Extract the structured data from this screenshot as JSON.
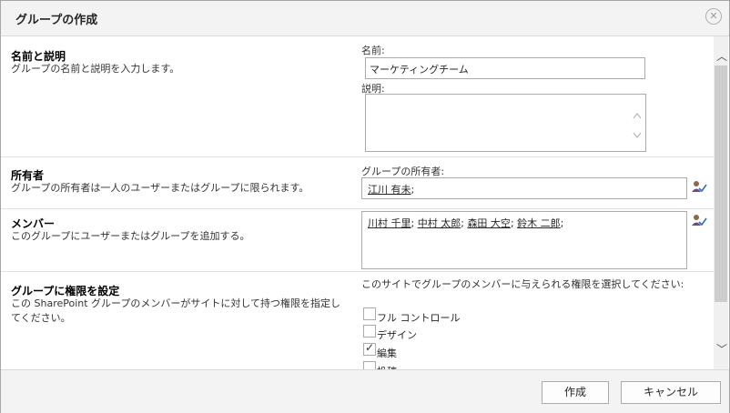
{
  "dialog": {
    "title": "グループの作成",
    "close_icon": "close-circle-icon"
  },
  "sections": {
    "name": {
      "title": "名前と説明",
      "description": "グループの名前と説明を入力します。",
      "name_label": "名前:",
      "name_value": "マーケティングチーム",
      "desc_label": "説明:",
      "desc_value": ""
    },
    "owner": {
      "title": "所有者",
      "description": "グループの所有者は一人のユーザーまたはグループに限られます。",
      "field_label": "グループの所有者:",
      "owner": "江川 有未",
      "separator": ";"
    },
    "members": {
      "title": "メンバー",
      "description": "このグループにユーザーまたはグループを追加する。",
      "people": [
        "川村 千里",
        "中村 太郎",
        "森田 大空",
        "鈴木 二郎"
      ],
      "separator": ";"
    },
    "permissions": {
      "title": "グループに権限を設定",
      "description": "この SharePoint グループのメンバーがサイトに対して持つ権限を指定してください。",
      "instruction": "このサイトでグループのメンバーに与えられる権限を選択してください:",
      "options": [
        {
          "label": "フル コントロール",
          "checked": false
        },
        {
          "label": "デザイン",
          "checked": false
        },
        {
          "label": "編集",
          "checked": true
        },
        {
          "label": "投稿",
          "checked": false
        }
      ]
    }
  },
  "footer": {
    "create_label": "作成",
    "cancel_label": "キャンセル"
  },
  "icons": {
    "check_names": "check-names-icon",
    "scroll_up": "scroll-up-icon",
    "scroll_down": "scroll-down-icon"
  }
}
